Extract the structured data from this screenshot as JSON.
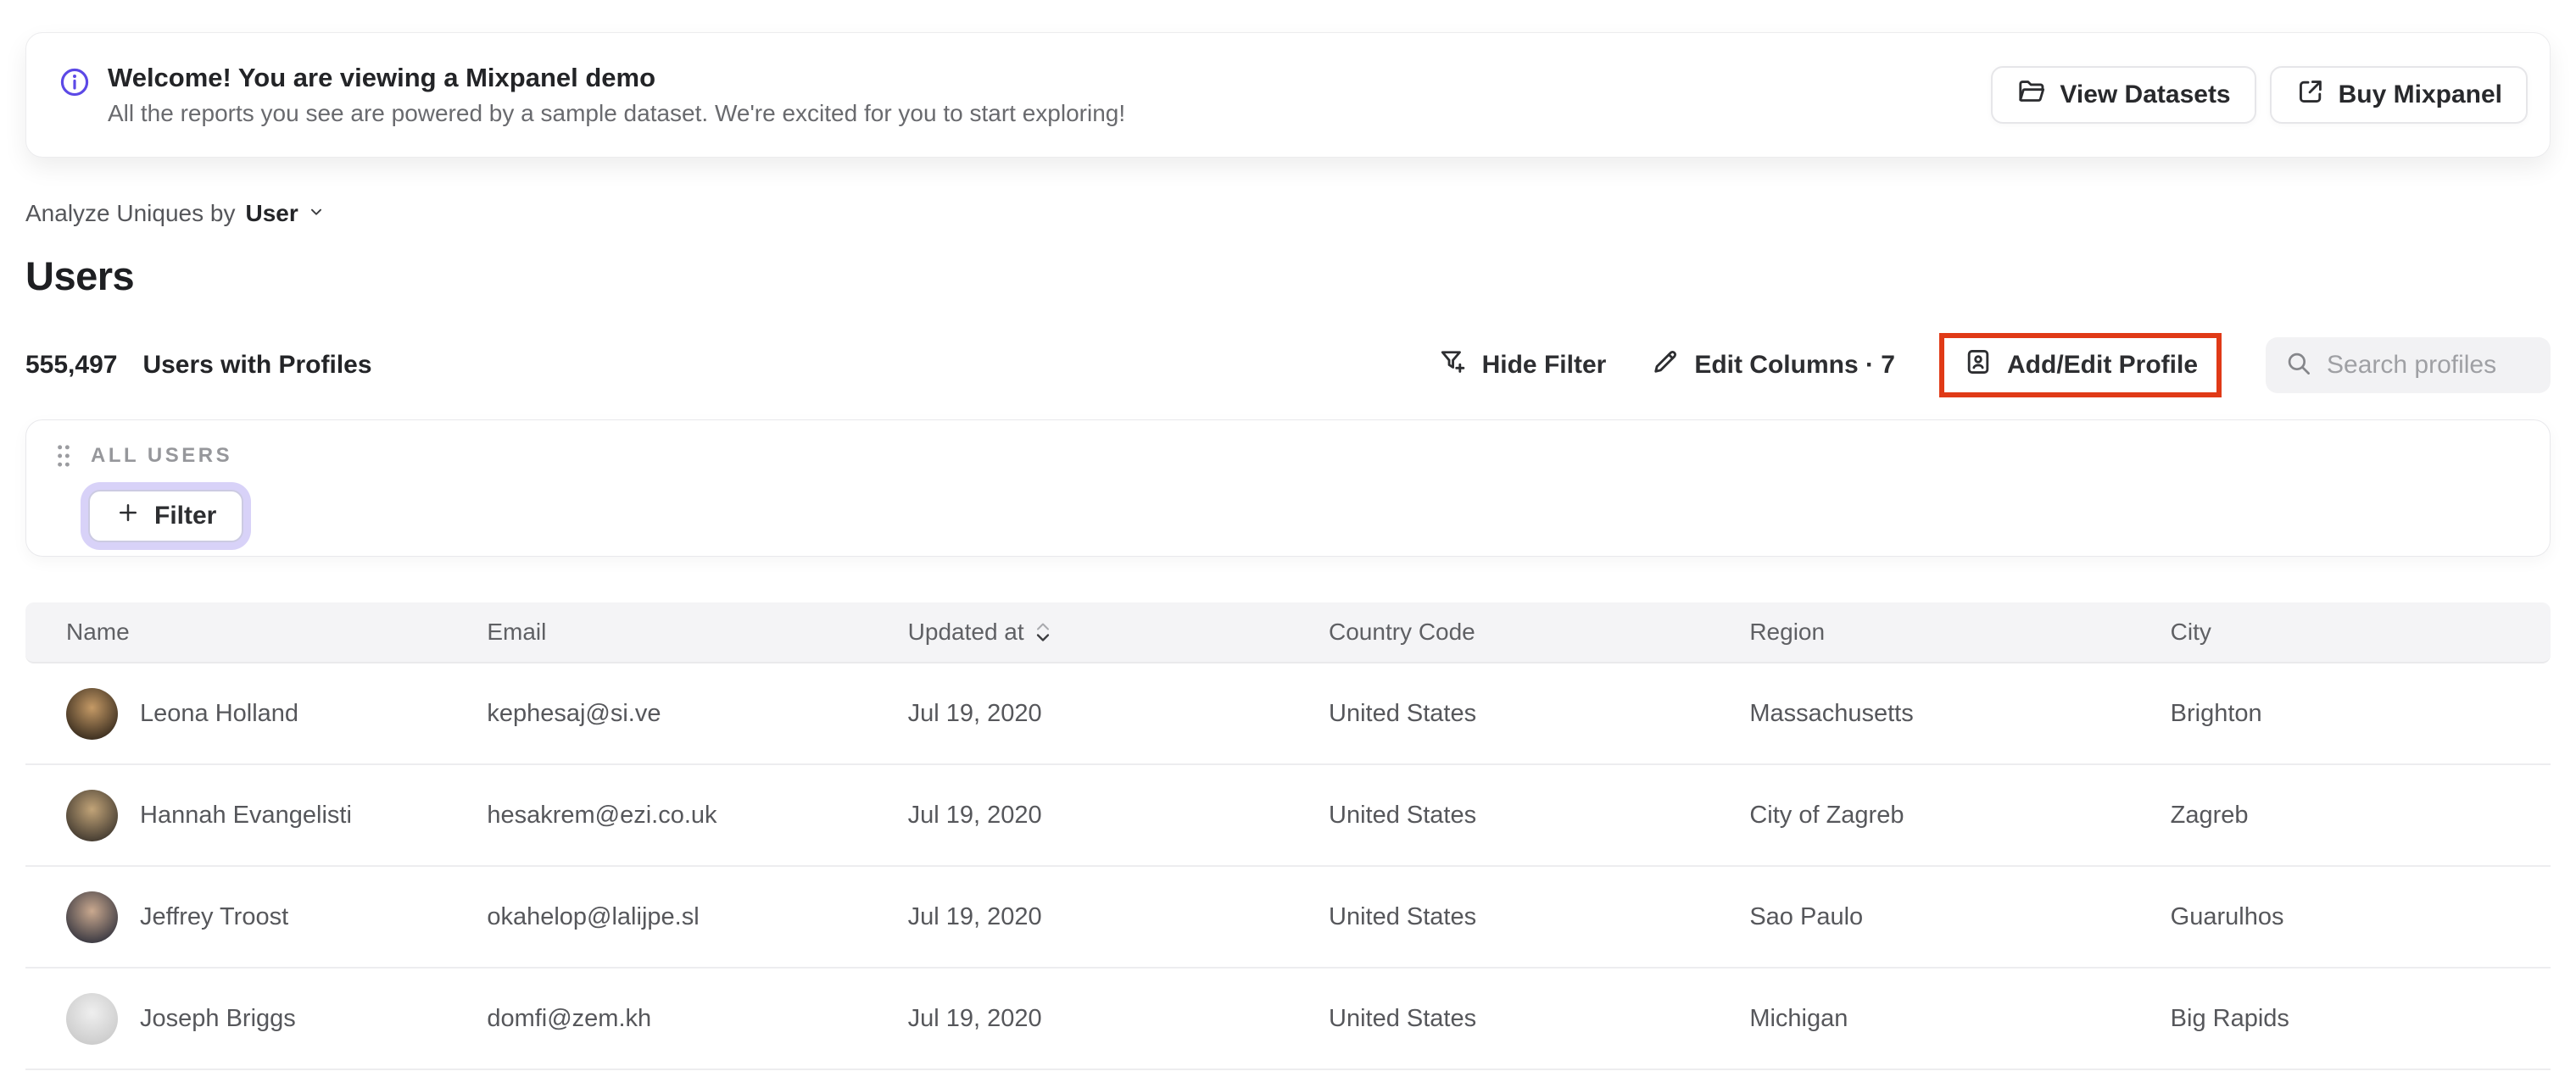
{
  "banner": {
    "title": "Welcome! You are viewing a Mixpanel demo",
    "subtitle": "All the reports you see are powered by a sample dataset. We're excited for you to start exploring!",
    "view_datasets_label": "View Datasets",
    "buy_mixpanel_label": "Buy Mixpanel"
  },
  "analyze": {
    "label": "Analyze Uniques by",
    "selected": "User"
  },
  "page_title": "Users",
  "stats": {
    "count": "555,497",
    "label": "Users with Profiles"
  },
  "toolbar": {
    "hide_filter_label": "Hide Filter",
    "edit_columns_label": "Edit Columns · 7",
    "add_edit_profile_label": "Add/Edit Profile",
    "search_placeholder": "Search profiles"
  },
  "filter_card": {
    "group_label": "ALL USERS",
    "add_filter_label": "Filter"
  },
  "table": {
    "columns": [
      "Name",
      "Email",
      "Updated at",
      "Country Code",
      "Region",
      "City"
    ],
    "sorted_column": "Updated at",
    "rows": [
      {
        "name": "Leona Holland",
        "email": "kephesaj@si.ve",
        "updated_at": "Jul 19, 2020",
        "country_code": "United States",
        "region": "Massachusetts",
        "city": "Brighton",
        "avatar": {
          "from": "#c59a66",
          "to": "#31261a"
        }
      },
      {
        "name": "Hannah Evangelisti",
        "email": "hesakrem@ezi.co.uk",
        "updated_at": "Jul 19, 2020",
        "country_code": "United States",
        "region": "City of Zagreb",
        "city": "Zagreb",
        "avatar": {
          "from": "#c2a478",
          "to": "#3b342c"
        }
      },
      {
        "name": "Jeffrey Troost",
        "email": "okahelop@lalijpe.sl",
        "updated_at": "Jul 19, 2020",
        "country_code": "United States",
        "region": "Sao Paulo",
        "city": "Guarulhos",
        "avatar": {
          "from": "#caa98f",
          "to": "#30313c"
        }
      },
      {
        "name": "Joseph Briggs",
        "email": "domfi@zem.kh",
        "updated_at": "Jul 19, 2020",
        "country_code": "United States",
        "region": "Michigan",
        "city": "Big Rapids",
        "avatar": {
          "from": "#efefef",
          "to": "#c9c9c9"
        }
      }
    ]
  },
  "colors": {
    "accent_purple": "#5c49e6",
    "annotation_red": "#e03a17",
    "focus_ring_lavender": "#d8d2f8"
  }
}
